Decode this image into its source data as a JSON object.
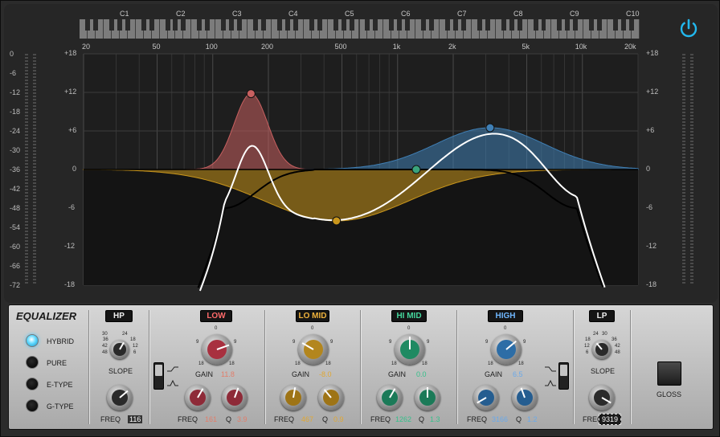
{
  "title": "EQUALIZER",
  "notes": [
    "C1",
    "C2",
    "C3",
    "C4",
    "C5",
    "C6",
    "C7",
    "C8",
    "C9",
    "C10"
  ],
  "freq_labels": [
    "20",
    "50",
    "100",
    "200",
    "500",
    "1k",
    "2k",
    "5k",
    "10k",
    "20k"
  ],
  "gain_labels_left": [
    "+18",
    "+12",
    "+6",
    "0",
    "-6",
    "-12",
    "-18"
  ],
  "gain_labels_right": [
    "+18",
    "+12",
    "+6",
    "0",
    "-6",
    "-12",
    "-18"
  ],
  "meter_labels": [
    "0",
    "-6",
    "-12",
    "-18",
    "-24",
    "-30",
    "-36",
    "-42",
    "-48",
    "-54",
    "-60",
    "-66",
    "-72"
  ],
  "power_icon": "power-icon",
  "colors": {
    "low": "#c86060",
    "lomid": "#c9961c",
    "himid": "#3aa37c",
    "high": "#3f7fb5",
    "accent": "#2ec3f2"
  },
  "modes": [
    {
      "label": "HYBRID",
      "active": true
    },
    {
      "label": "PURE",
      "active": false
    },
    {
      "label": "E-TYPE",
      "active": false
    },
    {
      "label": "G-TYPE",
      "active": false
    }
  ],
  "hp": {
    "name": "HP",
    "slope_label": "SLOPE",
    "slope_ticks": [
      "30",
      "24",
      "36",
      "18",
      "42",
      "12",
      "48",
      "6"
    ],
    "freq_label": "FREQ",
    "freq": "116"
  },
  "low": {
    "name": "LOW",
    "gain_label": "GAIN",
    "gain": "11.8",
    "freq_label": "FREQ",
    "freq": "161",
    "q_label": "Q",
    "q": "3.9",
    "scale": [
      "0",
      "9",
      "9",
      "18",
      "18"
    ]
  },
  "lomid": {
    "name": "LO MID",
    "gain_label": "GAIN",
    "gain": "-8.0",
    "freq_label": "FREQ",
    "freq": "467",
    "q_label": "Q",
    "q": "0.9",
    "scale": [
      "0",
      "9",
      "9",
      "18",
      "18"
    ]
  },
  "himid": {
    "name": "HI MID",
    "gain_label": "GAIN",
    "gain": "0.0",
    "freq_label": "FREQ",
    "freq": "1262",
    "q_label": "Q",
    "q": "1.3",
    "scale": [
      "0",
      "9",
      "9",
      "18",
      "18"
    ]
  },
  "high": {
    "name": "HIGH",
    "gain_label": "GAIN",
    "gain": "6.5",
    "freq_label": "FREQ",
    "freq": "3166",
    "q_label": "Q",
    "q": "1.2",
    "scale": [
      "0",
      "9",
      "9",
      "18",
      "18"
    ]
  },
  "lp": {
    "name": "LP",
    "slope_label": "SLOPE",
    "slope_ticks": [
      "24",
      "30",
      "18",
      "36",
      "12",
      "42",
      "6",
      "48"
    ],
    "freq_label": "FREQ",
    "freq": "9319"
  },
  "gloss_label": "GLOSS",
  "bands": [
    {
      "id": "low",
      "freq_hz": 161,
      "gain_db": 11.8,
      "q": 3.9
    },
    {
      "id": "lomid",
      "freq_hz": 467,
      "gain_db": -8.0,
      "q": 0.9
    },
    {
      "id": "himid",
      "freq_hz": 1262,
      "gain_db": 0.0,
      "q": 1.3
    },
    {
      "id": "high",
      "freq_hz": 3166,
      "gain_db": 6.5,
      "q": 1.2
    }
  ],
  "hp_freq_hz": 116,
  "lp_freq_hz": 9319
}
